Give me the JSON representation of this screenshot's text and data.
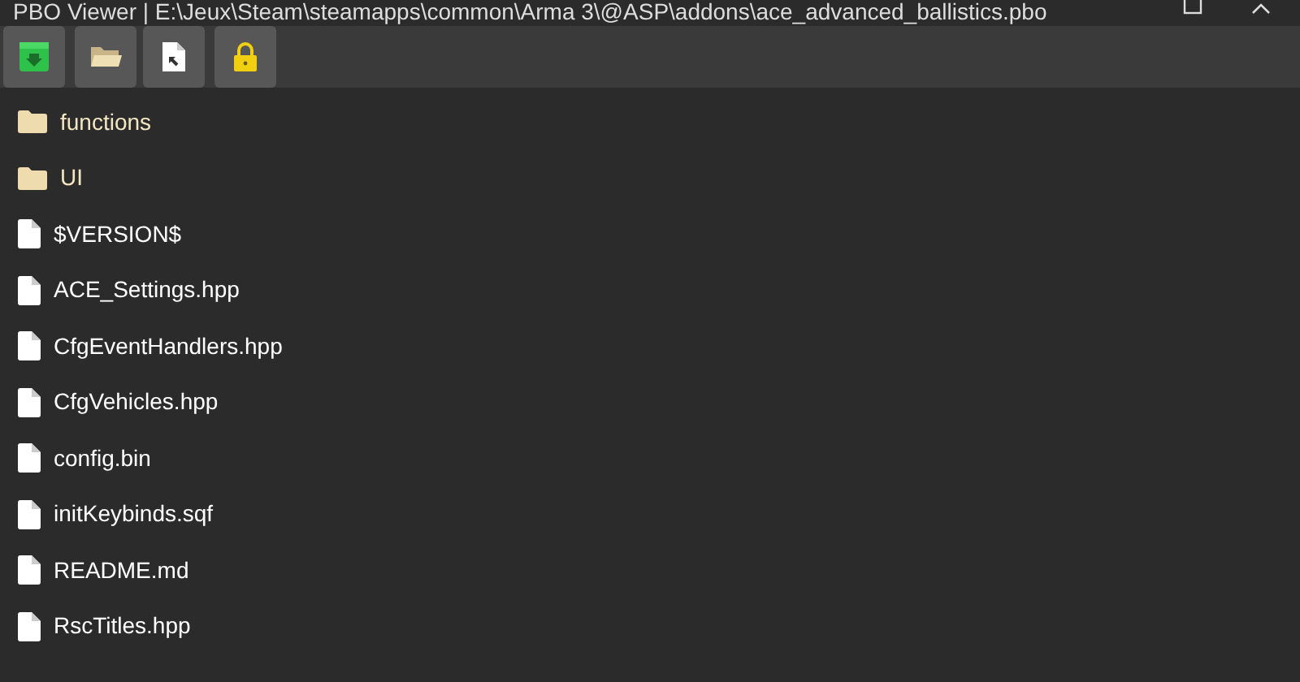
{
  "window": {
    "title": "PBO Viewer | E:\\Jeux\\Steam\\steamapps\\common\\Arma 3\\@ASP\\addons\\ace_advanced_ballistics.pbo"
  },
  "toolbar": [
    {
      "kind": "extract"
    },
    {
      "kind": "open"
    },
    {
      "kind": "import"
    },
    {
      "kind": "lock"
    }
  ],
  "files": [
    {
      "kind": "folder",
      "name": "functions"
    },
    {
      "kind": "folder",
      "name": "UI"
    },
    {
      "kind": "file",
      "name": "$VERSION$"
    },
    {
      "kind": "file",
      "name": "ACE_Settings.hpp"
    },
    {
      "kind": "file",
      "name": "CfgEventHandlers.hpp"
    },
    {
      "kind": "file",
      "name": "CfgVehicles.hpp"
    },
    {
      "kind": "file",
      "name": "config.bin"
    },
    {
      "kind": "file",
      "name": "initKeybinds.sqf"
    },
    {
      "kind": "file",
      "name": "README.md"
    },
    {
      "kind": "file",
      "name": "RscTitles.hpp"
    }
  ]
}
